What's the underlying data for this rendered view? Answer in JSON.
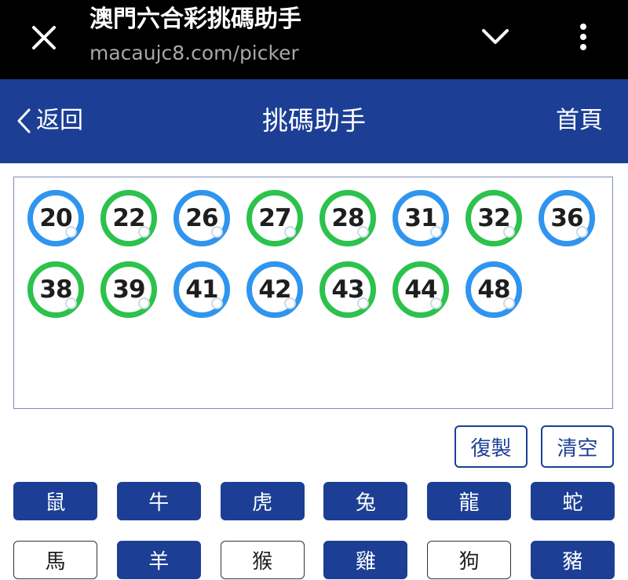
{
  "browser": {
    "title": "澳門六合彩挑碼助手",
    "url": "macaujc8.com/picker",
    "icons": [
      "close-icon",
      "chevron-down-icon",
      "more-vertical-icon"
    ]
  },
  "header": {
    "back_label": "返回",
    "title": "挑碼助手",
    "home_label": "首頁",
    "background": "#1c3f95"
  },
  "balls": [
    {
      "number": "20",
      "color": "blue"
    },
    {
      "number": "22",
      "color": "green"
    },
    {
      "number": "26",
      "color": "blue"
    },
    {
      "number": "27",
      "color": "green"
    },
    {
      "number": "28",
      "color": "green"
    },
    {
      "number": "31",
      "color": "blue"
    },
    {
      "number": "32",
      "color": "green"
    },
    {
      "number": "36",
      "color": "blue"
    },
    {
      "number": "38",
      "color": "green"
    },
    {
      "number": "39",
      "color": "green"
    },
    {
      "number": "41",
      "color": "blue"
    },
    {
      "number": "42",
      "color": "blue"
    },
    {
      "number": "43",
      "color": "green"
    },
    {
      "number": "44",
      "color": "green"
    },
    {
      "number": "48",
      "color": "blue"
    }
  ],
  "ball_colors": {
    "blue": "#2f95ee",
    "green": "#2cc24c"
  },
  "actions": {
    "copy_label": "復製",
    "clear_label": "清空"
  },
  "zodiac": [
    {
      "label": "鼠",
      "selected": true
    },
    {
      "label": "牛",
      "selected": true
    },
    {
      "label": "虎",
      "selected": true
    },
    {
      "label": "兔",
      "selected": true
    },
    {
      "label": "龍",
      "selected": true
    },
    {
      "label": "蛇",
      "selected": true
    },
    {
      "label": "馬",
      "selected": false
    },
    {
      "label": "羊",
      "selected": true
    },
    {
      "label": "猴",
      "selected": false
    },
    {
      "label": "雞",
      "selected": true
    },
    {
      "label": "狗",
      "selected": false
    },
    {
      "label": "豬",
      "selected": true
    }
  ]
}
